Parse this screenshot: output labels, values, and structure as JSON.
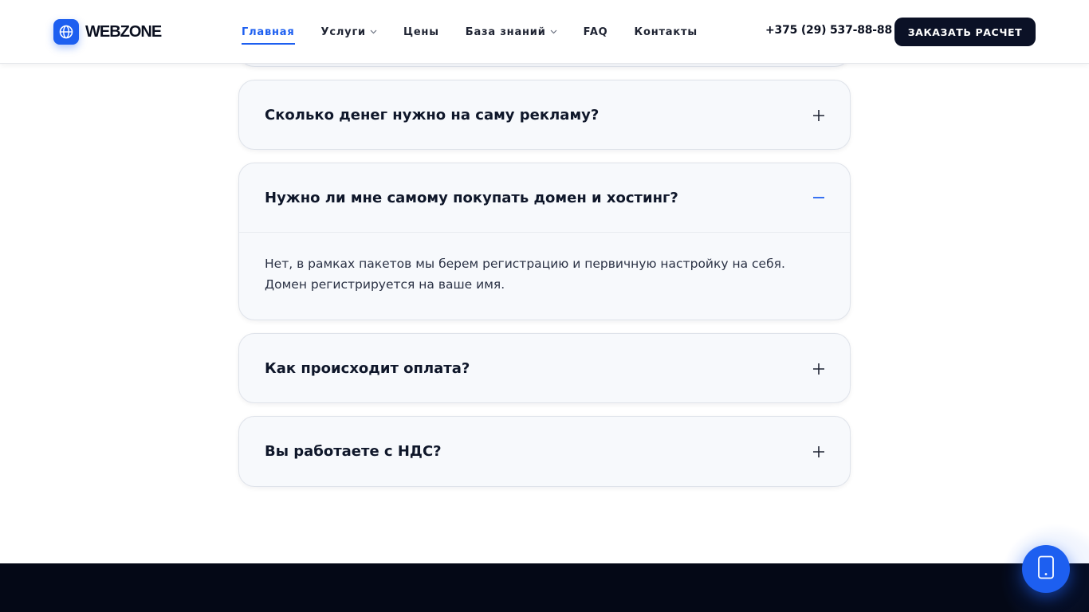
{
  "header": {
    "logo_text": "WEBZONE",
    "nav": [
      {
        "label": "Главная",
        "active": true,
        "has_dropdown": false
      },
      {
        "label": "Услуги",
        "active": false,
        "has_dropdown": true
      },
      {
        "label": "Цены",
        "active": false,
        "has_dropdown": false
      },
      {
        "label": "База знаний",
        "active": false,
        "has_dropdown": true
      },
      {
        "label": "FAQ",
        "active": false,
        "has_dropdown": false
      },
      {
        "label": "Контакты",
        "active": false,
        "has_dropdown": false
      }
    ],
    "phone": "+375 (29) 537-88-88",
    "cta_label": "ЗАКАЗАТЬ РАСЧЕТ"
  },
  "faq": {
    "items": [
      {
        "question": "Сколько денег нужно на саму рекламу?",
        "expanded": false
      },
      {
        "question": "Нужно ли мне самому покупать домен и хостинг?",
        "expanded": true,
        "answer_lines": [
          "Нет, в рамках пакетов мы берем регистрацию и первичную настройку на себя.",
          "Домен регистрируется на ваше имя."
        ]
      },
      {
        "question": "Как происходит оплата?",
        "expanded": false
      },
      {
        "question": "Вы работаете с НДС?",
        "expanded": false
      }
    ]
  },
  "colors": {
    "accent": "#1d5ff0",
    "dark": "#0b1126",
    "footer": "#040816"
  },
  "icons": {
    "logo": "globe-icon",
    "collapsed": "plus-icon",
    "expanded": "minus-icon",
    "dropdown": "chevron-down-icon",
    "float": "mobile-phone-icon"
  }
}
